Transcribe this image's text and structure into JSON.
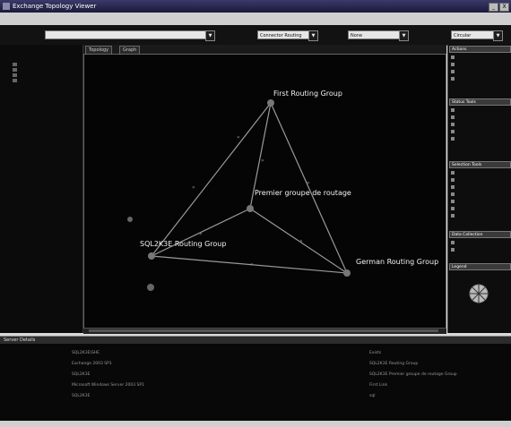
{
  "window": {
    "title": "Exchange Topology Viewer",
    "minimize": "_",
    "close": "X"
  },
  "toolbar": {
    "org_label": "",
    "org_value": "",
    "view_label": "",
    "view_value": "Connector Routing",
    "filter_label": "",
    "filter_value": "None",
    "layout_label": "",
    "layout_value": "Circular"
  },
  "left_tree": {
    "items": [
      "",
      "",
      "",
      ""
    ]
  },
  "canvas": {
    "tabs": [
      "Topology",
      "Graph"
    ],
    "zoom_text": "",
    "nodes": [
      {
        "label": "First Routing Group",
        "server": ""
      },
      {
        "label": "Premier groupe de routage",
        "server": ""
      },
      {
        "label": "SQL2K3E Routing Group",
        "server": ""
      },
      {
        "label": "German Routing Group",
        "server": ""
      },
      {
        "label": "",
        "server": ""
      },
      {
        "label": "",
        "server": ""
      }
    ]
  },
  "right_pane": {
    "sections": [
      {
        "title": "Actions",
        "items": [
          "",
          "",
          "",
          ""
        ]
      },
      {
        "title": "Status Tools",
        "items": [
          "",
          "",
          "",
          "",
          ""
        ]
      },
      {
        "title": "Selection Tools",
        "items": [
          "",
          "",
          "",
          "",
          "",
          "",
          ""
        ]
      },
      {
        "title": "Data Collection",
        "items": [
          "",
          ""
        ]
      },
      {
        "title": "Legend",
        "items": []
      }
    ]
  },
  "details": {
    "header": "Server Details",
    "left_rows": [
      {
        "label": "",
        "value": "SQL2K3E\\SHE"
      },
      {
        "label": "",
        "value": "Exchange 2003 SP1"
      },
      {
        "label": "",
        "value": "SQL2K3E"
      },
      {
        "label": "",
        "value": "Microsoft Windows Server 2003 SP1"
      },
      {
        "label": "",
        "value": "SQL2K3E"
      }
    ],
    "right_rows": [
      {
        "label": "",
        "value": "Exists"
      },
      {
        "label": "",
        "value": "SQL2K3E Routing Group"
      },
      {
        "label": "",
        "value": "SQL2K3E Premier groupe de routage Group"
      },
      {
        "label": "",
        "value": "First Link"
      },
      {
        "label": "",
        "value": "sql"
      }
    ]
  },
  "colors": {
    "canvas_bg": "#050505",
    "edge": "#9a9a9a",
    "node_text": "#f2f2f2"
  }
}
